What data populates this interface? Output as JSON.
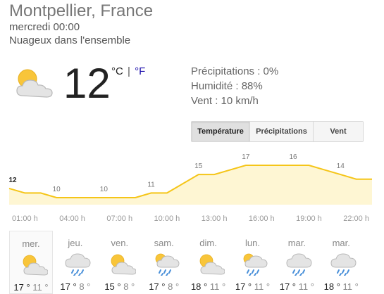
{
  "location": "Montpellier, France",
  "datetime": "mercredi 00:00",
  "condition": "Nuageux dans l'ensemble",
  "current": {
    "temp": "12",
    "unit_c": "°C",
    "unit_sep": "|",
    "unit_f": "°F",
    "icon": "partly-cloudy-icon"
  },
  "details": {
    "precipitation": "Précipitations : 0%",
    "humidity": "Humidité : 88%",
    "wind": "Vent : 10 km/h"
  },
  "tabs": {
    "temperature": "Température",
    "precipitation": "Précipitations",
    "wind": "Vent",
    "active": "temperature"
  },
  "colors": {
    "line": "#f5c518",
    "fill": "#fef6d3",
    "link": "#1a0dab"
  },
  "chart_data": {
    "type": "area",
    "x": [
      "00:00",
      "01:00",
      "02:00",
      "03:00",
      "04:00",
      "05:00",
      "06:00",
      "07:00",
      "08:00",
      "09:00",
      "10:00",
      "11:00",
      "12:00",
      "13:00",
      "14:00",
      "15:00",
      "16:00",
      "17:00",
      "18:00",
      "19:00",
      "20:00",
      "21:00",
      "22:00",
      "23:00"
    ],
    "values": [
      12,
      11,
      11,
      10,
      10,
      10,
      10,
      10,
      10,
      11,
      11,
      13,
      15,
      15,
      16,
      17,
      17,
      17,
      17,
      17,
      16,
      15,
      14,
      14
    ],
    "labeled_values": [
      "12",
      "",
      "",
      "10",
      "",
      "",
      "10",
      "",
      "",
      "11",
      "",
      "",
      "15",
      "",
      "",
      "17",
      "",
      "",
      "16",
      "",
      "",
      "14",
      "",
      ""
    ],
    "tick_labels": [
      "01:00 h",
      "04:00 h",
      "07:00 h",
      "10:00 h",
      "13:00 h",
      "16:00 h",
      "19:00 h",
      "22:00 h"
    ],
    "ylim": [
      10,
      17
    ],
    "grid": false
  },
  "days": [
    {
      "name": "mer.",
      "icon": "partly-cloudy-icon",
      "high": "17 °",
      "low": "11 °"
    },
    {
      "name": "jeu.",
      "icon": "rain-icon",
      "high": "17 °",
      "low": "8 °"
    },
    {
      "name": "ven.",
      "icon": "partly-cloudy-icon",
      "high": "15 °",
      "low": "8 °"
    },
    {
      "name": "sam.",
      "icon": "rain-sun-icon",
      "high": "17 °",
      "low": "8 °"
    },
    {
      "name": "dim.",
      "icon": "partly-cloudy-icon",
      "high": "18 °",
      "low": "11 °"
    },
    {
      "name": "lun.",
      "icon": "rain-sun-icon",
      "high": "17 °",
      "low": "11 °"
    },
    {
      "name": "mar.",
      "icon": "rain-icon",
      "high": "17 °",
      "low": "11 °"
    },
    {
      "name": "mar.",
      "icon": "rain-icon",
      "high": "18 °",
      "low": "11 °"
    }
  ]
}
